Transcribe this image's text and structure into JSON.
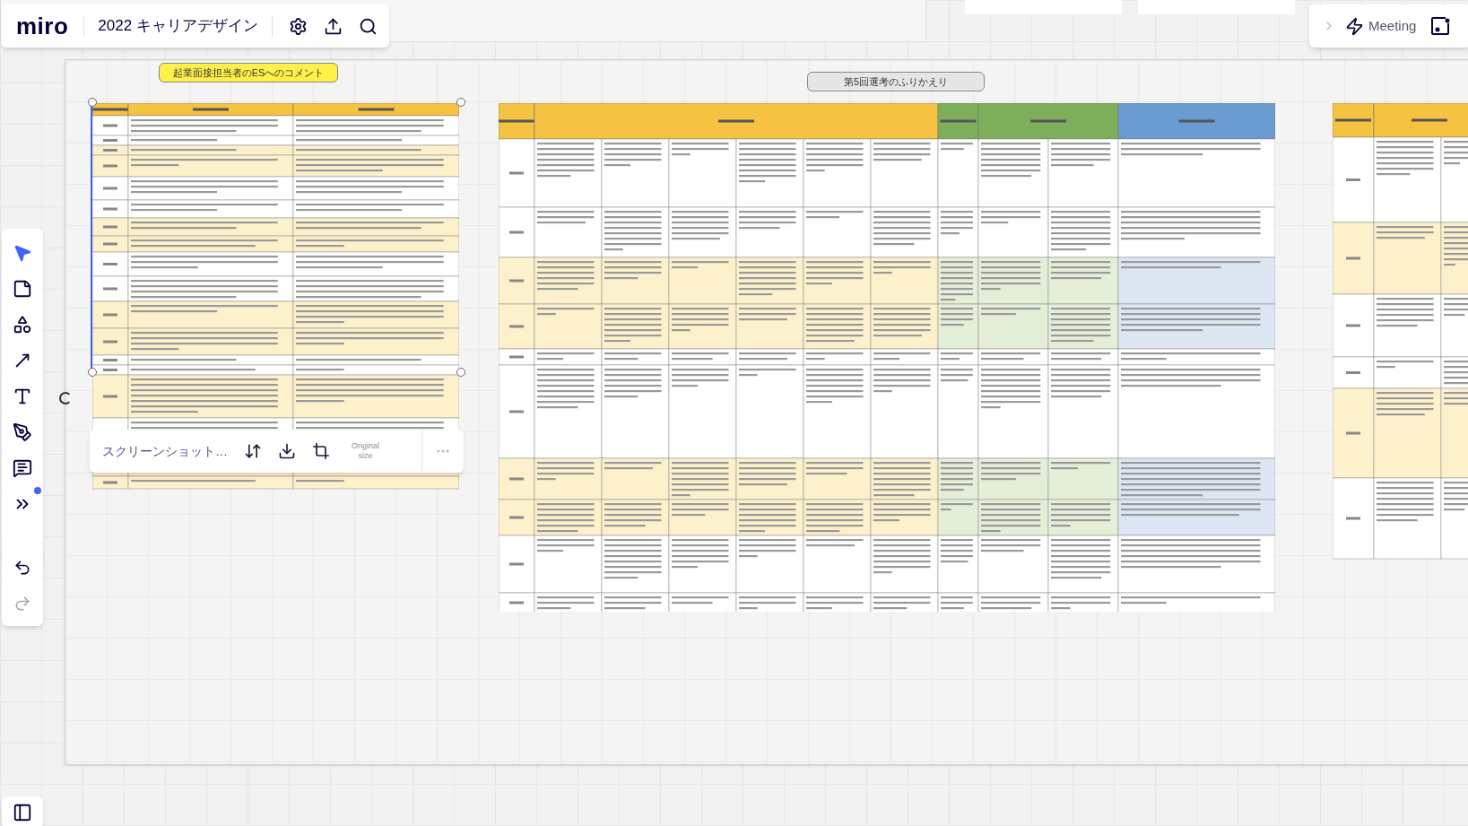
{
  "top_bar": {
    "logo": "miro",
    "board_title": "2022 キャリアデザイン",
    "actions": [
      {
        "kind": "settings"
      },
      {
        "kind": "share"
      },
      {
        "kind": "search"
      }
    ]
  },
  "meeting_bar": {
    "label": "Meeting"
  },
  "tools": [
    {
      "kind": "select",
      "selected": true
    },
    {
      "kind": "sticky",
      "selected": false
    },
    {
      "kind": "shapes",
      "selected": false
    },
    {
      "kind": "arrow",
      "selected": false
    },
    {
      "kind": "text",
      "selected": false
    },
    {
      "kind": "pen",
      "selected": false
    },
    {
      "kind": "comment",
      "selected": false
    },
    {
      "kind": "more",
      "selected": false
    }
  ],
  "history": [
    {
      "kind": "undo",
      "disabled": false
    },
    {
      "kind": "redo",
      "disabled": true
    }
  ],
  "board": {
    "labels": [
      {
        "text": "起業面接担当者のESへのコメント",
        "color": "#fff04a"
      },
      {
        "text": "第5回選考のふりかえり",
        "color": "#e6e6e6"
      }
    ]
  },
  "image_toolbar": {
    "name": "スクリーンショット…",
    "size_button": [
      "Original",
      "size"
    ]
  }
}
